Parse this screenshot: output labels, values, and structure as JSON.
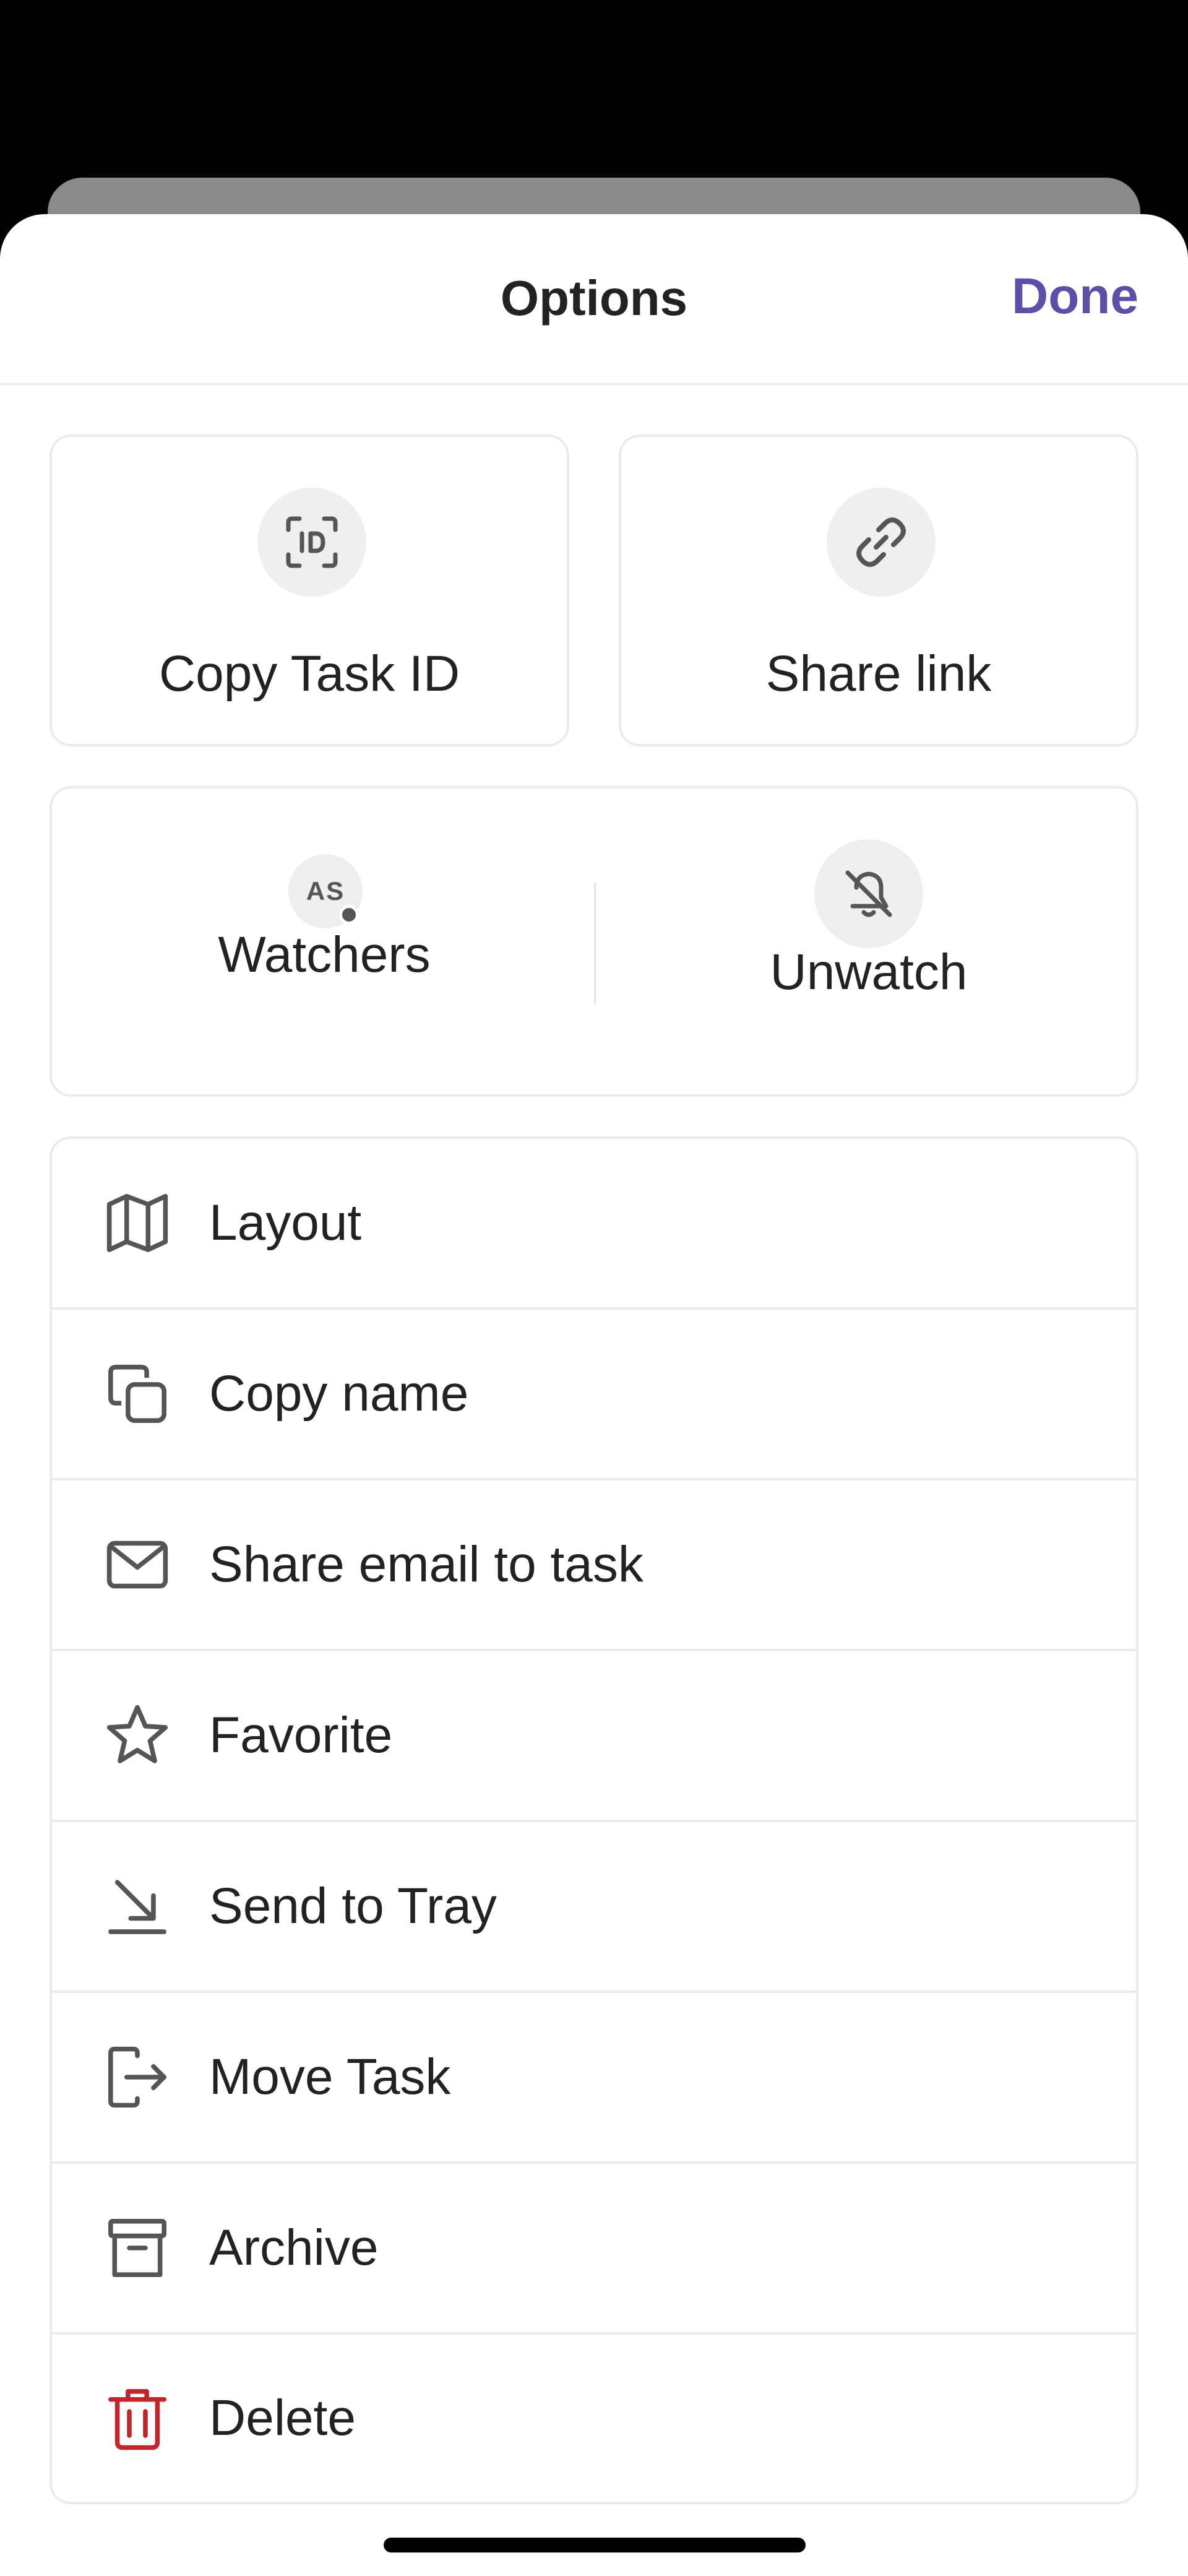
{
  "header": {
    "title": "Options",
    "done_label": "Done"
  },
  "tiles": {
    "copy_task_id": {
      "label": "Copy Task ID",
      "icon": "id-icon"
    },
    "share_link": {
      "label": "Share link",
      "icon": "link-icon"
    }
  },
  "watch": {
    "watchers": {
      "label": "Watchers",
      "avatar_initials": "AS"
    },
    "unwatch": {
      "label": "Unwatch",
      "icon": "bell-off-icon"
    }
  },
  "menu": {
    "items": [
      {
        "label": "Layout",
        "icon": "layout-icon"
      },
      {
        "label": "Copy name",
        "icon": "copy-icon"
      },
      {
        "label": "Share email to task",
        "icon": "mail-icon"
      },
      {
        "label": "Favorite",
        "icon": "star-icon"
      },
      {
        "label": "Send to Tray",
        "icon": "send-to-tray-icon"
      },
      {
        "label": "Move Task",
        "icon": "move-icon"
      },
      {
        "label": "Archive",
        "icon": "archive-icon"
      },
      {
        "label": "Delete",
        "icon": "trash-icon"
      }
    ]
  },
  "colors": {
    "accent": "#5b4fa8",
    "danger": "#c0262d",
    "icon": "#555555",
    "border": "#ebebeb"
  }
}
